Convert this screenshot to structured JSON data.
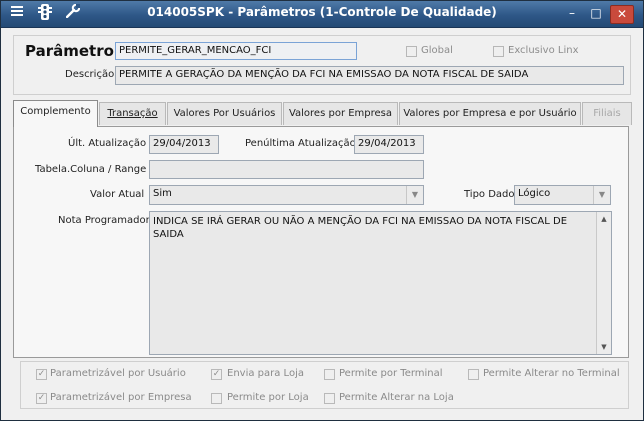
{
  "window": {
    "title": "014005SPK - Parâmetros (1-Controle De Qualidade)",
    "icons": [
      "menu-icon",
      "traffic-light-icon",
      "wrench-icon"
    ],
    "controls": {
      "minimize": "–",
      "maximize": "□",
      "close": "✕"
    }
  },
  "header": {
    "parametro_label": "Parâmetro",
    "parametro_value": "PERMITE_GERAR_MENCAO_FCI",
    "global_label": "Global",
    "exclusivo_label": "Exclusivo Linx",
    "descricao_label": "Descrição",
    "descricao_value": "PERMITE A GERAÇÃO DA MENÇÃO DA FCI NA EMISSAO DA NOTA FISCAL DE SAIDA"
  },
  "tabs": [
    {
      "label": "Complemento",
      "active": true
    },
    {
      "label": "Transação"
    },
    {
      "label": "Valores Por Usuários"
    },
    {
      "label": "Valores por Empresa"
    },
    {
      "label": "Valores por Empresa e por Usuário"
    },
    {
      "label": "Filiais",
      "disabled": true
    }
  ],
  "complemento": {
    "ult_atualizacao_label": "Últ. Atualização",
    "ult_atualizacao_value": "29/04/2013",
    "penultima_label": "Penúltima Atualização",
    "penultima_value": "29/04/2013",
    "tabela_coluna_label": "Tabela.Coluna / Range",
    "tabela_coluna_value": "",
    "valor_atual_label": "Valor Atual",
    "valor_atual_value": "Sim",
    "tipo_dado_label": "Tipo Dado",
    "tipo_dado_value": "Lógico",
    "nota_programador_label": "Nota Programador",
    "nota_programador_value": "INDICA SE IRÁ GERAR OU NÃO A MENÇÃO DA FCI NA EMISSAO DA NOTA FISCAL DE SAIDA"
  },
  "options": {
    "parametrizavel_usuario": {
      "label": "Parametrizável por Usuário",
      "checked": true
    },
    "envia_loja": {
      "label": "Envia para Loja",
      "checked": true
    },
    "permite_terminal": {
      "label": "Permite por Terminal",
      "checked": false
    },
    "permite_alterar_terminal": {
      "label": "Permite Alterar no Terminal",
      "checked": false
    },
    "parametrizavel_empresa": {
      "label": "Parametrizável por Empresa",
      "checked": true
    },
    "permite_loja": {
      "label": "Permite por Loja",
      "checked": false
    },
    "permite_alterar_loja": {
      "label": "Permite Alterar na Loja",
      "checked": false
    }
  }
}
